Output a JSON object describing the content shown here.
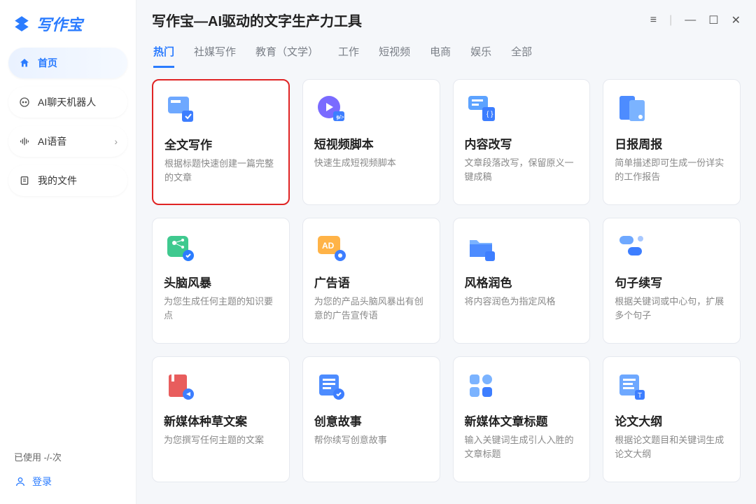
{
  "logo": "写作宝",
  "sidebar": {
    "items": [
      {
        "label": "首页"
      },
      {
        "label": "AI聊天机器人"
      },
      {
        "label": "AI语音"
      },
      {
        "label": "我的文件"
      }
    ]
  },
  "usage": "已使用 -/-次",
  "login": "登录",
  "header": {
    "title": "写作宝—AI驱动的文字生产力工具"
  },
  "tabs": [
    "热门",
    "社媒写作",
    "教育（文学）",
    "工作",
    "短视频",
    "电商",
    "娱乐",
    "全部"
  ],
  "cards": [
    {
      "title": "全文写作",
      "desc": "根据标题快速创建一篇完整的文章"
    },
    {
      "title": "短视频脚本",
      "desc": "快速生成短视频脚本"
    },
    {
      "title": "内容改写",
      "desc": "文章段落改写，保留原义一键成稿"
    },
    {
      "title": "日报周报",
      "desc": "简单描述即可生成一份详实的工作报告"
    },
    {
      "title": "头脑风暴",
      "desc": "为您生成任何主题的知识要点"
    },
    {
      "title": "广告语",
      "desc": "为您的产品头脑风暴出有创意的广告宣传语"
    },
    {
      "title": "风格润色",
      "desc": "将内容润色为指定风格"
    },
    {
      "title": "句子续写",
      "desc": "根据关键词或中心句，扩展多个句子"
    },
    {
      "title": "新媒体种草文案",
      "desc": "为您撰写任何主题的文案"
    },
    {
      "title": "创意故事",
      "desc": "帮你续写创意故事"
    },
    {
      "title": "新媒体文章标题",
      "desc": "输入关键词生成引人入胜的文章标题"
    },
    {
      "title": "论文大纲",
      "desc": "根据论文题目和关键词生成论文大纲"
    }
  ]
}
